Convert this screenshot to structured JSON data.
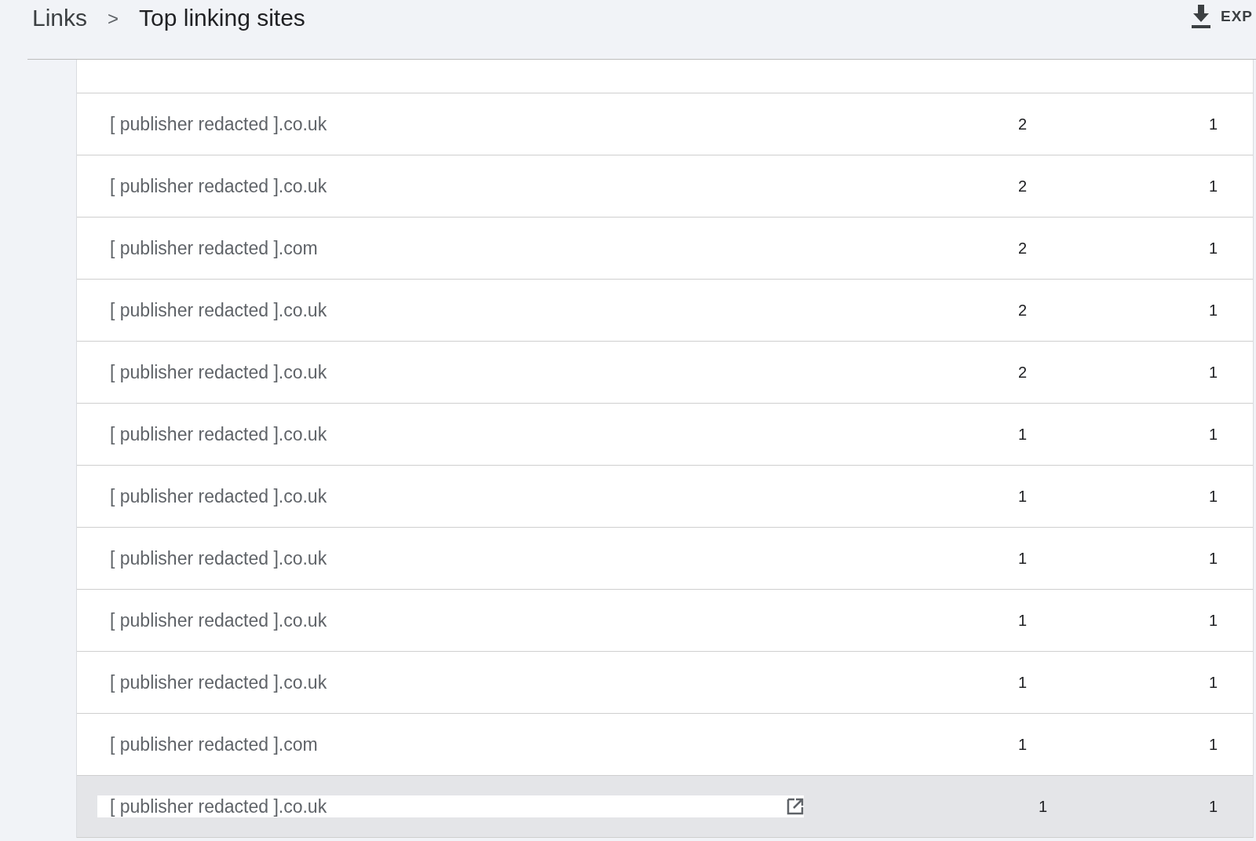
{
  "breadcrumb": {
    "parent": "Links",
    "separator": ">",
    "current": "Top linking sites"
  },
  "export_button": {
    "label": "EXP"
  },
  "rows": [
    {
      "site": "[ publisher redacted ].co.uk",
      "column_2": "2",
      "column_3": "1",
      "highlighted": false
    },
    {
      "site": "[ publisher redacted ].co.uk",
      "column_2": "2",
      "column_3": "1",
      "highlighted": false
    },
    {
      "site": "[ publisher redacted ].com",
      "column_2": "2",
      "column_3": "1",
      "highlighted": false
    },
    {
      "site": "[ publisher redacted ].co.uk",
      "column_2": "2",
      "column_3": "1",
      "highlighted": false
    },
    {
      "site": "[ publisher redacted ].co.uk",
      "column_2": "2",
      "column_3": "1",
      "highlighted": false
    },
    {
      "site": "[ publisher redacted ].co.uk",
      "column_2": "1",
      "column_3": "1",
      "highlighted": false
    },
    {
      "site": "[ publisher redacted ].co.uk",
      "column_2": "1",
      "column_3": "1",
      "highlighted": false
    },
    {
      "site": "[ publisher redacted ].co.uk",
      "column_2": "1",
      "column_3": "1",
      "highlighted": false
    },
    {
      "site": "[ publisher redacted ].co.uk",
      "column_2": "1",
      "column_3": "1",
      "highlighted": false
    },
    {
      "site": "[ publisher redacted ].co.uk",
      "column_2": "1",
      "column_3": "1",
      "highlighted": false
    },
    {
      "site": "[ publisher redacted ].com",
      "column_2": "1",
      "column_3": "1",
      "highlighted": false
    },
    {
      "site": "[ publisher redacted ].co.uk",
      "column_2": "1",
      "column_3": "1",
      "highlighted": true
    }
  ]
}
